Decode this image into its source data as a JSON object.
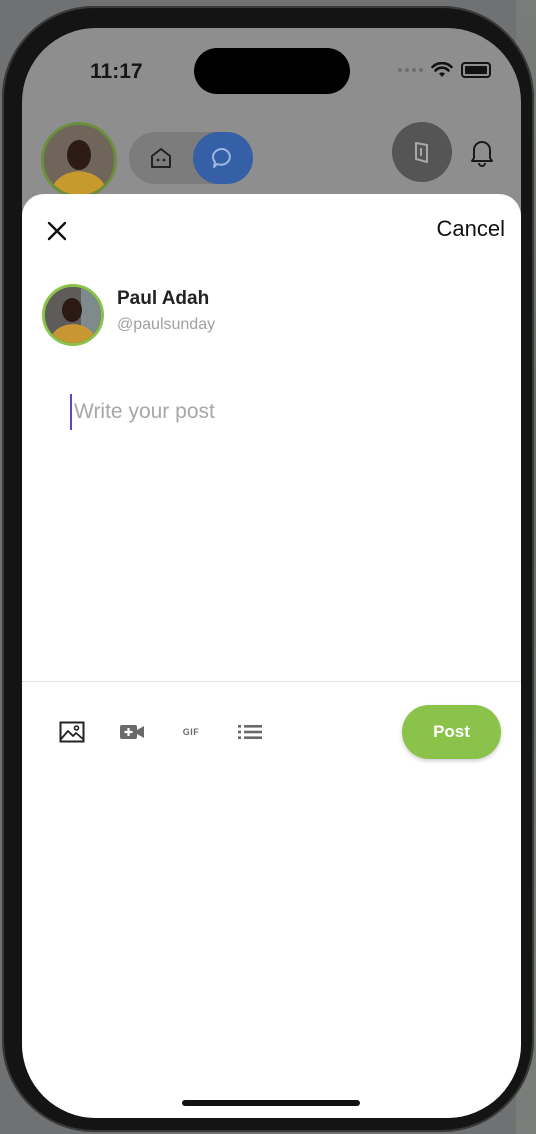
{
  "status_bar": {
    "time": "11:17"
  },
  "background_app": {
    "nav": {
      "home_icon": "home-icon",
      "messages_icon": "chat-bubble-icon"
    },
    "notifications_icon": "bell-icon"
  },
  "sheet": {
    "close_icon": "close-icon",
    "cancel_label": "Cancel",
    "user": {
      "name": "Paul Adah",
      "handle": "@paulsunday"
    },
    "composer": {
      "placeholder": "Write your post",
      "value": ""
    },
    "toolbar": {
      "items": [
        "image-icon",
        "video-icon",
        "gif-icon",
        "list-icon"
      ],
      "gif_label": "GIF",
      "post_label": "Post"
    }
  },
  "colors": {
    "accent": "#8bc34a",
    "nav_active": "#3560a8",
    "caret": "#5a48c9"
  }
}
